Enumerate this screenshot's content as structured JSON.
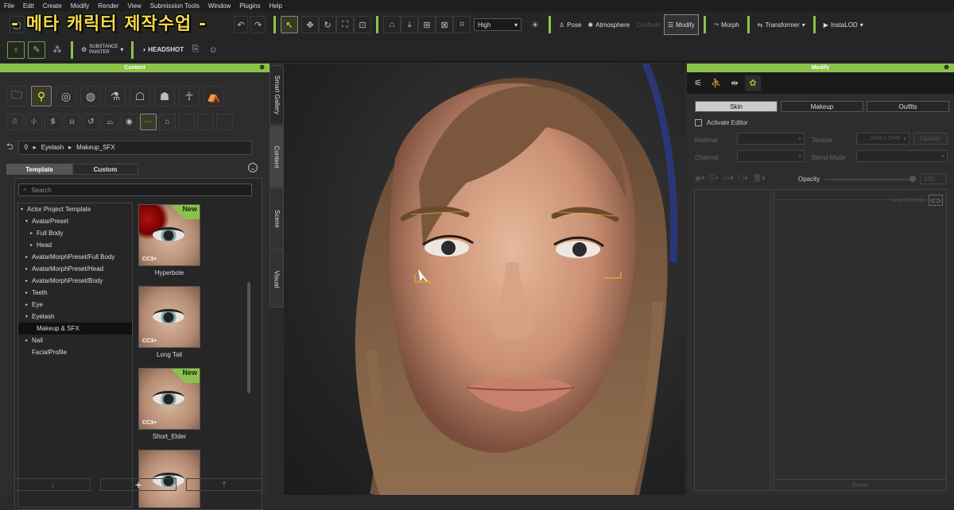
{
  "menu": [
    "File",
    "Edit",
    "Create",
    "Modify",
    "Render",
    "View",
    "Submission Tools",
    "Window",
    "Plugins",
    "Help"
  ],
  "banner": "- 메타 캐릭터 제작수업 -",
  "toolbar": {
    "quality": "High",
    "pose": "Pose",
    "atmosphere": "Atmosphere",
    "conform": "Conform",
    "modify": "Modify",
    "morph": "Morph",
    "transformer": "Transformer",
    "instalod": "InstaLOD",
    "substance_top": "SUBSTANCE",
    "substance_bottom": "PAINTER",
    "headshot": "HEADSHOT"
  },
  "content_panel": {
    "title": "Content",
    "breadcrumb": [
      "Eyelash",
      "Makeup_SFX"
    ],
    "tabs": [
      "Template",
      "Custom"
    ],
    "search_placeholder": "Search",
    "tree": [
      {
        "label": "Actor Project Template",
        "indent": 0,
        "arrow": "▾"
      },
      {
        "label": "AvatarPreset",
        "indent": 1,
        "arrow": "▾"
      },
      {
        "label": "Full Body",
        "indent": 2,
        "arrow": "▸"
      },
      {
        "label": "Head",
        "indent": 2,
        "arrow": "▸"
      },
      {
        "label": "AvatarMorphPreset/Full Body",
        "indent": 1,
        "arrow": "▸"
      },
      {
        "label": "AvatarMorphPreset/Head",
        "indent": 1,
        "arrow": "▸"
      },
      {
        "label": "AvatarMorphPreset/Body",
        "indent": 1,
        "arrow": "▸"
      },
      {
        "label": "Teeth",
        "indent": 1,
        "arrow": "▸"
      },
      {
        "label": "Eye",
        "indent": 1,
        "arrow": "▸"
      },
      {
        "label": "Eyelash",
        "indent": 1,
        "arrow": "▾"
      },
      {
        "label": "Makeup & SFX",
        "indent": 2,
        "arrow": "",
        "selected": true
      },
      {
        "label": "Nail",
        "indent": 1,
        "arrow": "▸"
      },
      {
        "label": "FacialProfile",
        "indent": 1,
        "arrow": ""
      }
    ],
    "thumbnails": [
      {
        "name": "Hyperbole",
        "badge": "New",
        "red": true
      },
      {
        "name": "Long Tail",
        "badge": ""
      },
      {
        "name": "Short_Elder",
        "badge": "New"
      },
      {
        "name": "",
        "badge": ""
      }
    ],
    "thumb_logo": "CC3+",
    "add_symbol": "+"
  },
  "vertical_tabs": [
    "Smart Gallery",
    "Content",
    "Scene",
    "Visual"
  ],
  "modify_panel": {
    "title": "Modify",
    "subtabs": [
      "Skin",
      "Makeup",
      "Outfits"
    ],
    "activate_editor": "Activate Editor",
    "material_label": "Material",
    "texture_label": "Texture",
    "texture_value": "2048 x 2048",
    "update_label": "Update",
    "channel_label": "Channel",
    "blend_mode_label": "Blend Mode",
    "opacity_label": "Opacity",
    "opacity_value": "100",
    "link_controls": "Link Controls",
    "reset": "Reset"
  },
  "colors": {
    "accent": "#8bc34a",
    "banner": "#f5d84a"
  }
}
